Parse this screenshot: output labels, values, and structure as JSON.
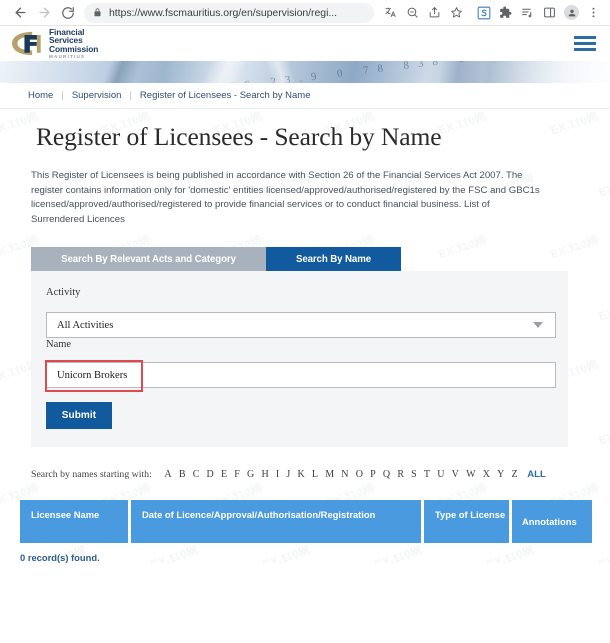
{
  "browser": {
    "url": "https://www.fscmauritius.org/en/supervision/regi...",
    "back_label": "Back",
    "forward_label": "Forward",
    "reload_label": "Reload",
    "lock_icon": "lock-icon",
    "toolbar_icons": [
      "translate-icon",
      "zoom-out-icon",
      "share-icon",
      "bookmark-star-icon",
      "extension-s-icon",
      "extensions-puzzle-icon",
      "reading-list-icon",
      "side-panel-icon",
      "profile-avatar-icon",
      "chrome-menu-icon"
    ]
  },
  "header": {
    "logo": {
      "line1": "Financial",
      "line2": "Services",
      "line3": "Commission",
      "line4": "MAURITIUS"
    },
    "menu_label": "Menu"
  },
  "breadcrumb": {
    "items": [
      "Home",
      "Supervision",
      "Register of Licensees - Search by Name"
    ],
    "separator": "|"
  },
  "main": {
    "title": "Register of Licensees - Search by Name",
    "intro": "This Register of Licensees is being published in accordance with Section 26 of the Financial Services Act 2007. The register contains information only for 'domestic' entities licensed/approved/authorised/registered by the FSC and GBC1s licensed/approved/authorised/registered to provide financial services or to conduct financial business. List of Surrendered Licences",
    "tabs": [
      {
        "label": "Search By Relevant Acts and Category",
        "active": false
      },
      {
        "label": "Search By Name",
        "active": true
      }
    ],
    "form": {
      "activity_label": "Activity",
      "activity_value": "All Activities",
      "activity_placeholder": "All Activities",
      "name_label": "Name",
      "name_value": "Unicorn Brokers",
      "name_placeholder": "",
      "submit_label": "Submit"
    },
    "alphabet": {
      "lead": "Search by names starting with:",
      "letters": [
        "A",
        "B",
        "C",
        "D",
        "E",
        "F",
        "G",
        "H",
        "I",
        "J",
        "K",
        "L",
        "M",
        "N",
        "O",
        "P",
        "Q",
        "R",
        "S",
        "T",
        "U",
        "V",
        "W",
        "X",
        "Y",
        "Z"
      ],
      "all_label": "ALL"
    },
    "table": {
      "headers": [
        "Licensee Name",
        "Date of Licence/Approval/Authorisation/Registration",
        "Type of License",
        "Annotations"
      ],
      "rows": [],
      "record_count_text": "0 record(s) found."
    }
  },
  "colors": {
    "tab_active": "#125a9e",
    "tab_inactive": "#a8b2bd",
    "submit": "#125a9e",
    "table_header": "#4a9ae0",
    "annotation_red": "#dc4b52",
    "link_blue": "#2d6ca5",
    "logo_navy": "#1a3a5c",
    "logo_gold": "#b8a06a"
  },
  "watermark": {
    "text": "EX.110网"
  }
}
